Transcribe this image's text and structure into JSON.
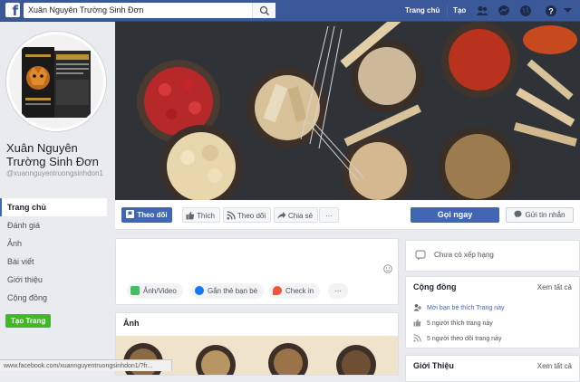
{
  "topbar": {
    "logo": "f",
    "search_value": "Xuân Nguyên Trường Sinh Đơn",
    "home_label": "Trang chủ",
    "create_label": "Tạo"
  },
  "page": {
    "name": "Xuân Nguyên Trường Sinh Đơn",
    "handle": "@xuannguyentruongsinhdon1"
  },
  "leftnav": {
    "items": [
      "Trang chủ",
      "Đánh giá",
      "Ảnh",
      "Bài viết",
      "Giới thiệu",
      "Cộng đồng"
    ],
    "create_page": "Tạo Trang"
  },
  "actions": {
    "follow_main": "Theo dõi",
    "like": "Thích",
    "follow": "Theo dõi",
    "share": "Chia sẻ",
    "more": "···",
    "call_now": "Gọi ngay",
    "send_message": "Gửi tin nhắn"
  },
  "composer": {
    "photo_video": "Ảnh/Video",
    "tag_friends": "Gắn thẻ bạn bè",
    "check_in": "Check in",
    "more": "···"
  },
  "photos": {
    "title": "Ảnh"
  },
  "rating": {
    "text": "Chưa có xếp hạng"
  },
  "community": {
    "title": "Cộng đồng",
    "see_all": "Xem tất cả",
    "invite": "Mời bạn bè thích Trang này",
    "likes": "5 người thích trang này",
    "follows": "5 người theo dõi trang này"
  },
  "about": {
    "title": "Giới Thiệu",
    "see_all": "Xem tất cả"
  },
  "status_url": "www.facebook.com/xuannguyentruongsinhdon1/?fr...",
  "colors": {
    "brand": "#3b5998",
    "primary_button": "#4267b2",
    "create_button": "#42b72a"
  }
}
